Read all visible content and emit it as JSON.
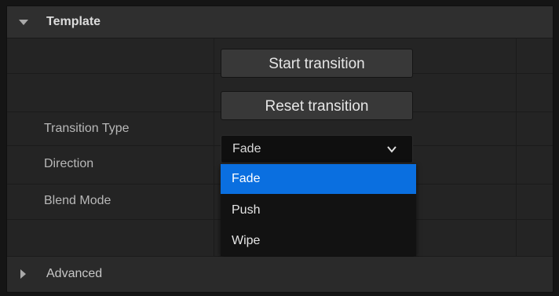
{
  "section": {
    "title": "Template",
    "icon": "triangle-down-icon"
  },
  "buttons": {
    "start": "Start transition",
    "reset": "Reset transition"
  },
  "properties": {
    "transition_type_label": "Transition Type",
    "direction_label": "Direction",
    "blend_mode_label": "Blend Mode"
  },
  "combo": {
    "value": "Fade",
    "icon": "chevron-down-icon"
  },
  "dropdown": {
    "options": [
      "Fade",
      "Push",
      "Wipe"
    ],
    "selected_index": 0,
    "highlight_color": "#0a6fe0"
  },
  "advanced": {
    "label": "Advanced",
    "icon": "triangle-right-icon"
  }
}
